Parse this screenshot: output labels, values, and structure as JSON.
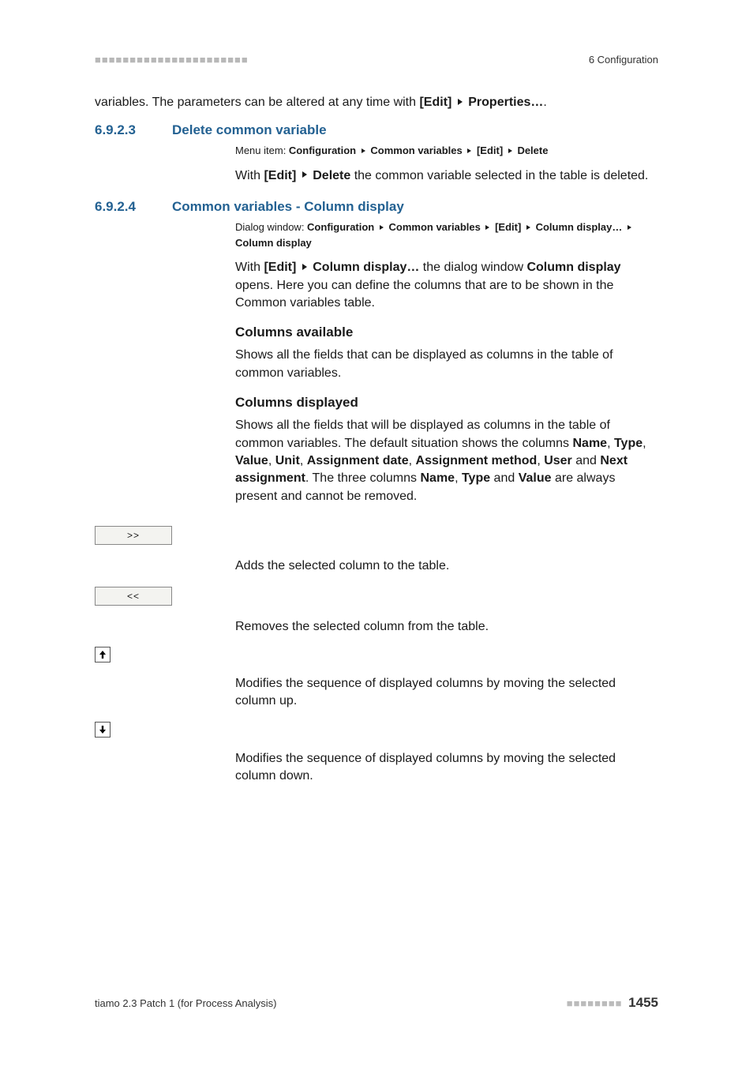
{
  "header": {
    "left_marks": "■■■■■■■■■■■■■■■■■■■■■■",
    "right": "6 Configuration"
  },
  "intro": {
    "p1a": "variables. The parameters can be altered at any time with ",
    "p1b": "[Edit]",
    "p1c": "Properties…",
    "p1d": "."
  },
  "s6923": {
    "num": "6.9.2.3",
    "title": "Delete common variable",
    "menu_prefix": "Menu item: ",
    "menu_parts": [
      "Configuration",
      "Common variables",
      "[Edit]",
      "Delete"
    ],
    "p1_a": "With ",
    "p1_b": "[Edit]",
    "p1_c": "Delete",
    "p1_d": " the common variable selected in the table is deleted."
  },
  "s6924": {
    "num": "6.9.2.4",
    "title": "Common variables - Column display",
    "menu_prefix": "Dialog window: ",
    "menu_parts": [
      "Configuration",
      "Common variables",
      "[Edit]",
      "Column display…",
      "Column display"
    ],
    "p1_a": "With ",
    "p1_b": "[Edit]",
    "p1_c": "Column display…",
    "p1_d": " the dialog window ",
    "p1_e": "Column display",
    "p1_f": " opens. Here you can define the columns that are to be shown in the Common variables table.",
    "cols_avail_head": "Columns available",
    "cols_avail_body": "Shows all the fields that can be displayed as columns in the table of common variables.",
    "cols_disp_head": "Columns displayed",
    "cols_disp_a": "Shows all the fields that will be displayed as columns in the table of common variables. The default situation shows the columns ",
    "cols_list": [
      "Name",
      "Type",
      "Value",
      "Unit",
      "Assignment date",
      "Assignment method",
      "User",
      "Next assignment"
    ],
    "cols_disp_b": ". The three columns ",
    "cols_tail_list": [
      "Name",
      "Type",
      "Value"
    ],
    "cols_disp_c": " are always present and cannot be removed."
  },
  "actions": {
    "add_label": ">>",
    "add_desc": "Adds the selected column to the table.",
    "remove_label": "<<",
    "remove_desc": "Removes the selected column from the table.",
    "up_desc": "Modifies the sequence of displayed columns by moving the selected column up.",
    "down_desc": "Modifies the sequence of displayed columns by moving the selected column down."
  },
  "footer": {
    "left": "tiamo 2.3 Patch 1 (for Process Analysis)",
    "right_marks": "■■■■■■■■",
    "page": "1455"
  },
  "sep": {
    "comma": ", ",
    "and": " and "
  }
}
